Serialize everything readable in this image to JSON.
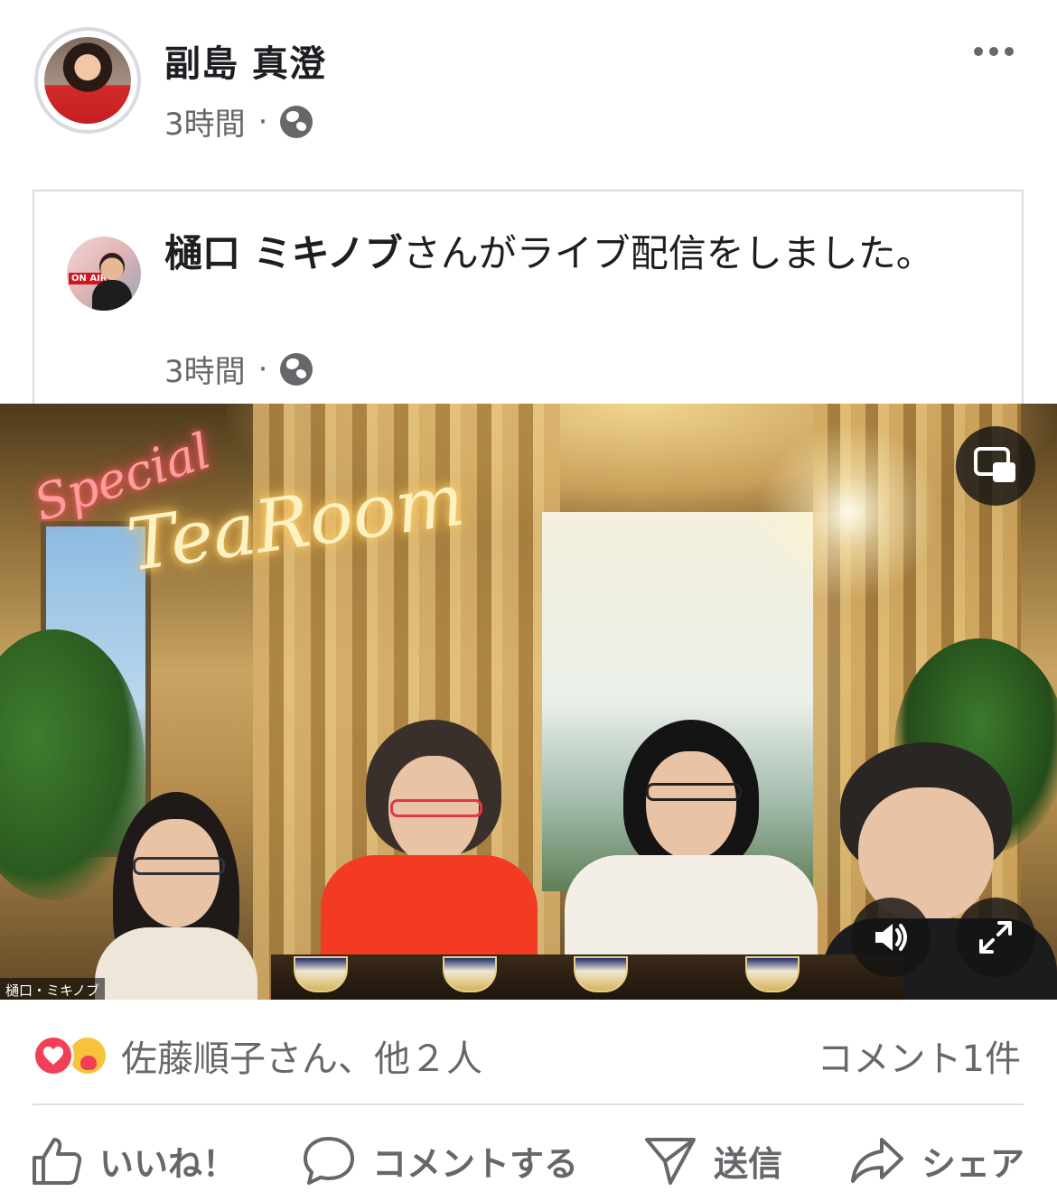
{
  "post": {
    "author": "副島 真澄",
    "time": "3時間",
    "separator": "·",
    "more_icon": "more-dots-icon",
    "privacy_icon": "globe-icon"
  },
  "shared": {
    "author": "樋口 ミキノブ",
    "action_text": "さんがライブ配信をしました。",
    "time": "3時間",
    "separator": "·",
    "avatar_badge": "ON AIR"
  },
  "video": {
    "participant_label": "樋口・ミキノブ",
    "pip_icon": "picture-in-picture-icon",
    "volume_icon": "volume-icon",
    "fullscreen_icon": "expand-icon"
  },
  "engagement": {
    "reactions_text": "佐藤順子さん、他２人",
    "comments_text": "コメント1件",
    "reaction_icons": [
      "love-reaction-icon",
      "care-reaction-icon"
    ]
  },
  "actions": {
    "like": "いいね！",
    "comment": "コメントする",
    "send": "送信",
    "share": "シェア"
  },
  "colors": {
    "secondary_text": "#65676b",
    "love": "#f33e58",
    "care": "#f7c33d"
  }
}
